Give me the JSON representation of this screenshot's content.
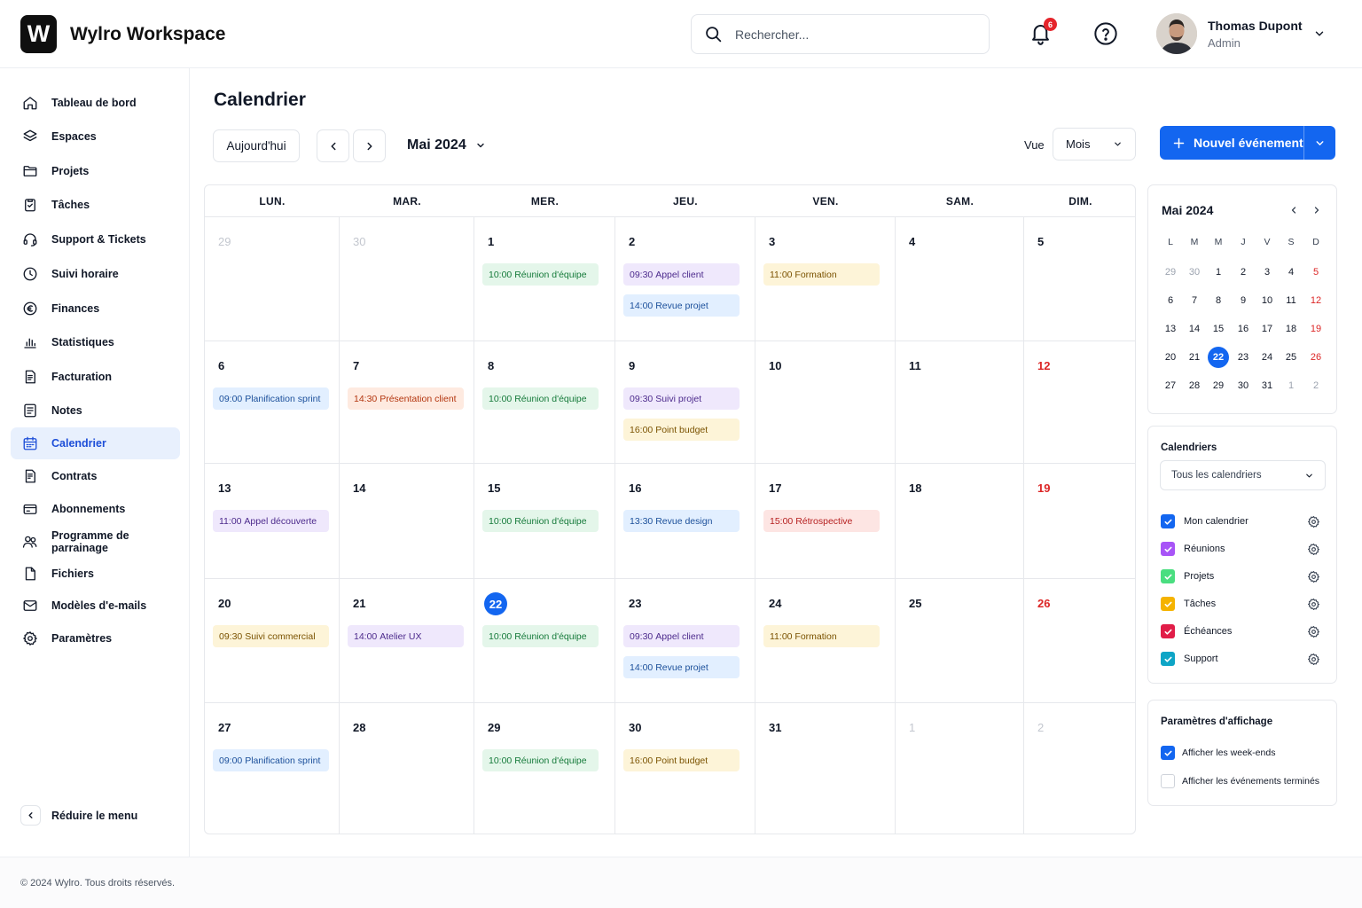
{
  "app": {
    "logo_letter": "W",
    "brand": "Wylro Workspace"
  },
  "header": {
    "search_placeholder": "Rechercher...",
    "notifications_count": "6",
    "user_name": "Thomas Dupont",
    "user_role": "Admin"
  },
  "sidebar": {
    "items": [
      {
        "label": "Tableau de bord",
        "icon": "home-icon"
      },
      {
        "label": "Espaces",
        "icon": "layers-icon"
      },
      {
        "label": "Projets",
        "icon": "folder-icon"
      },
      {
        "label": "Tâches",
        "icon": "clipboard-check-icon"
      },
      {
        "label": "Support & Tickets",
        "icon": "headset-icon"
      },
      {
        "label": "Suivi horaire",
        "icon": "clock-icon"
      },
      {
        "label": "Finances",
        "icon": "euro-icon"
      },
      {
        "label": "Statistiques",
        "icon": "chart-icon"
      },
      {
        "label": "Facturation",
        "icon": "invoice-icon"
      },
      {
        "label": "Notes",
        "icon": "note-icon"
      },
      {
        "label": "Calendrier",
        "icon": "calendar-icon"
      },
      {
        "label": "Contrats",
        "icon": "contract-icon"
      },
      {
        "label": "Abonnements",
        "icon": "card-icon"
      },
      {
        "label": "Programme de parrainage",
        "icon": "users-icon"
      },
      {
        "label": "Fichiers",
        "icon": "file-icon"
      },
      {
        "label": "Modèles d'e-mails",
        "icon": "mail-icon"
      },
      {
        "label": "Paramètres",
        "icon": "gear-icon"
      }
    ],
    "collapse_label": "Réduire le menu"
  },
  "page": {
    "title": "Calendrier",
    "today_button": "Aujourd'hui",
    "current_month": "Mai 2024",
    "view_label": "Vue",
    "view_value": "Mois",
    "new_event_button": "Nouvel événement"
  },
  "calendar": {
    "weekdays": [
      "LUN.",
      "MAR.",
      "MER.",
      "JEU.",
      "VEN.",
      "SAM.",
      "DIM."
    ],
    "weeks": [
      [
        {
          "day": "29",
          "muted": true,
          "events": []
        },
        {
          "day": "30",
          "muted": true,
          "events": []
        },
        {
          "day": "1",
          "events": [
            {
              "time": "10:00",
              "title": "Réunion d'équipe",
              "color": "green"
            }
          ]
        },
        {
          "day": "2",
          "events": [
            {
              "time": "09:30",
              "title": "Appel client",
              "color": "purple"
            },
            {
              "time": "14:00",
              "title": "Revue projet",
              "color": "blue"
            }
          ]
        },
        {
          "day": "3",
          "events": [
            {
              "time": "11:00",
              "title": "Formation",
              "color": "yellow"
            }
          ]
        },
        {
          "day": "4",
          "events": []
        },
        {
          "day": "5",
          "events": []
        }
      ],
      [
        {
          "day": "6",
          "events": [
            {
              "time": "09:00",
              "title": "Planification sprint",
              "color": "blue"
            }
          ]
        },
        {
          "day": "7",
          "events": [
            {
              "time": "14:30",
              "title": "Présentation client",
              "color": "orange"
            }
          ]
        },
        {
          "day": "8",
          "events": [
            {
              "time": "10:00",
              "title": "Réunion d'équipe",
              "color": "green"
            }
          ]
        },
        {
          "day": "9",
          "events": [
            {
              "time": "09:30",
              "title": "Suivi projet",
              "color": "purple"
            },
            {
              "time": "16:00",
              "title": "Point budget",
              "color": "yellow"
            }
          ]
        },
        {
          "day": "10",
          "events": []
        },
        {
          "day": "11",
          "events": []
        },
        {
          "day": "12",
          "sunday": true,
          "events": []
        }
      ],
      [
        {
          "day": "13",
          "events": [
            {
              "time": "11:00",
              "title": "Appel découverte",
              "color": "purple"
            }
          ]
        },
        {
          "day": "14",
          "events": []
        },
        {
          "day": "15",
          "events": [
            {
              "time": "10:00",
              "title": "Réunion d'équipe",
              "color": "green"
            }
          ]
        },
        {
          "day": "16",
          "events": [
            {
              "time": "13:30",
              "title": "Revue design",
              "color": "blue"
            }
          ]
        },
        {
          "day": "17",
          "events": [
            {
              "time": "15:00",
              "title": "Rétrospective",
              "color": "red"
            }
          ]
        },
        {
          "day": "18",
          "events": []
        },
        {
          "day": "19",
          "sunday": true,
          "events": []
        }
      ],
      [
        {
          "day": "20",
          "events": [
            {
              "time": "09:30",
              "title": "Suivi commercial",
              "color": "yellow"
            }
          ]
        },
        {
          "day": "21",
          "events": [
            {
              "time": "14:00",
              "title": "Atelier UX",
              "color": "purple"
            }
          ]
        },
        {
          "day": "22",
          "today": true,
          "events": [
            {
              "time": "10:00",
              "title": "Réunion d'équipe",
              "color": "green"
            }
          ]
        },
        {
          "day": "23",
          "events": [
            {
              "time": "09:30",
              "title": "Appel client",
              "color": "purple"
            },
            {
              "time": "14:00",
              "title": "Revue projet",
              "color": "blue"
            }
          ]
        },
        {
          "day": "24",
          "events": [
            {
              "time": "11:00",
              "title": "Formation",
              "color": "yellow"
            }
          ]
        },
        {
          "day": "25",
          "events": []
        },
        {
          "day": "26",
          "sunday": true,
          "events": []
        }
      ],
      [
        {
          "day": "27",
          "events": [
            {
              "time": "09:00",
              "title": "Planification sprint",
              "color": "blue"
            }
          ]
        },
        {
          "day": "28",
          "events": []
        },
        {
          "day": "29",
          "events": [
            {
              "time": "10:00",
              "title": "Réunion d'équipe",
              "color": "green"
            }
          ]
        },
        {
          "day": "30",
          "events": [
            {
              "time": "16:00",
              "title": "Point budget",
              "color": "yellow"
            }
          ]
        },
        {
          "day": "31",
          "events": []
        },
        {
          "day": "1",
          "muted": true,
          "events": []
        },
        {
          "day": "2",
          "muted": true,
          "events": []
        }
      ]
    ]
  },
  "mini_calendar": {
    "title": "Mai 2024",
    "weekdays": [
      "L",
      "M",
      "M",
      "J",
      "V",
      "S",
      "D"
    ],
    "days": [
      [
        "29",
        "30",
        "1",
        "2",
        "3",
        "4",
        "5"
      ],
      [
        "6",
        "7",
        "8",
        "9",
        "10",
        "11",
        "12"
      ],
      [
        "13",
        "14",
        "15",
        "16",
        "17",
        "18",
        "19"
      ],
      [
        "20",
        "21",
        "22",
        "23",
        "24",
        "25",
        "26"
      ],
      [
        "27",
        "28",
        "29",
        "30",
        "31",
        "1",
        "2"
      ]
    ],
    "muted": [
      [
        0,
        0
      ],
      [
        0,
        1
      ],
      [
        4,
        5
      ],
      [
        4,
        6
      ]
    ],
    "today": [
      3,
      2
    ]
  },
  "calendars_panel": {
    "title": "Calendriers",
    "select_value": "Tous les calendriers",
    "items": [
      {
        "label": "Mon calendrier",
        "color": "#1366f0"
      },
      {
        "label": "Réunions",
        "color": "#a855f7"
      },
      {
        "label": "Projets",
        "color": "#4ade80"
      },
      {
        "label": "Tâches",
        "color": "#f5b300"
      },
      {
        "label": "Échéances",
        "color": "#e11d48"
      },
      {
        "label": "Support",
        "color": "#0ea5c6"
      }
    ]
  },
  "display_settings": {
    "title": "Paramètres d'affichage",
    "options": [
      {
        "label": "Afficher les week-ends",
        "checked": true
      },
      {
        "label": "Afficher les événements terminés",
        "checked": false
      }
    ]
  },
  "footer": {
    "copyright": "© 2024 Wylro. Tous droits réservés."
  }
}
